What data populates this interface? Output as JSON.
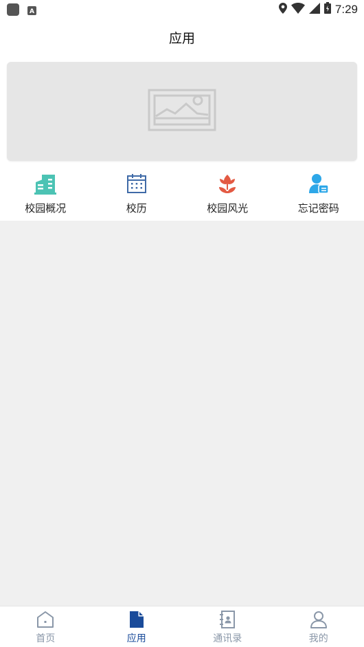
{
  "status_bar": {
    "time": "7:29",
    "left_icons": [
      "app-icon",
      "keyboard-a-icon"
    ],
    "right_icons": [
      "location-icon",
      "wifi-icon",
      "signal-icon",
      "battery-icon"
    ]
  },
  "header": {
    "title": "应用"
  },
  "banner": {
    "icon": "image-placeholder-icon"
  },
  "grid": {
    "items": [
      {
        "label": "校园概况",
        "icon": "building-icon",
        "color": "#4cc3b4"
      },
      {
        "label": "校历",
        "icon": "calendar-icon",
        "color": "#3f6aa7"
      },
      {
        "label": "校园风光",
        "icon": "flower-icon",
        "color": "#e35a43"
      },
      {
        "label": "忘记密码",
        "icon": "user-key-icon",
        "color": "#2da7e8"
      }
    ]
  },
  "tabbar": {
    "active": "应用",
    "active_color": "#1a4b9a",
    "inactive_color": "#8a97a8",
    "tabs": [
      {
        "label": "首页",
        "icon": "home-icon"
      },
      {
        "label": "应用",
        "icon": "document-icon"
      },
      {
        "label": "通讯录",
        "icon": "contacts-book-icon"
      },
      {
        "label": "我的",
        "icon": "person-icon"
      }
    ]
  }
}
